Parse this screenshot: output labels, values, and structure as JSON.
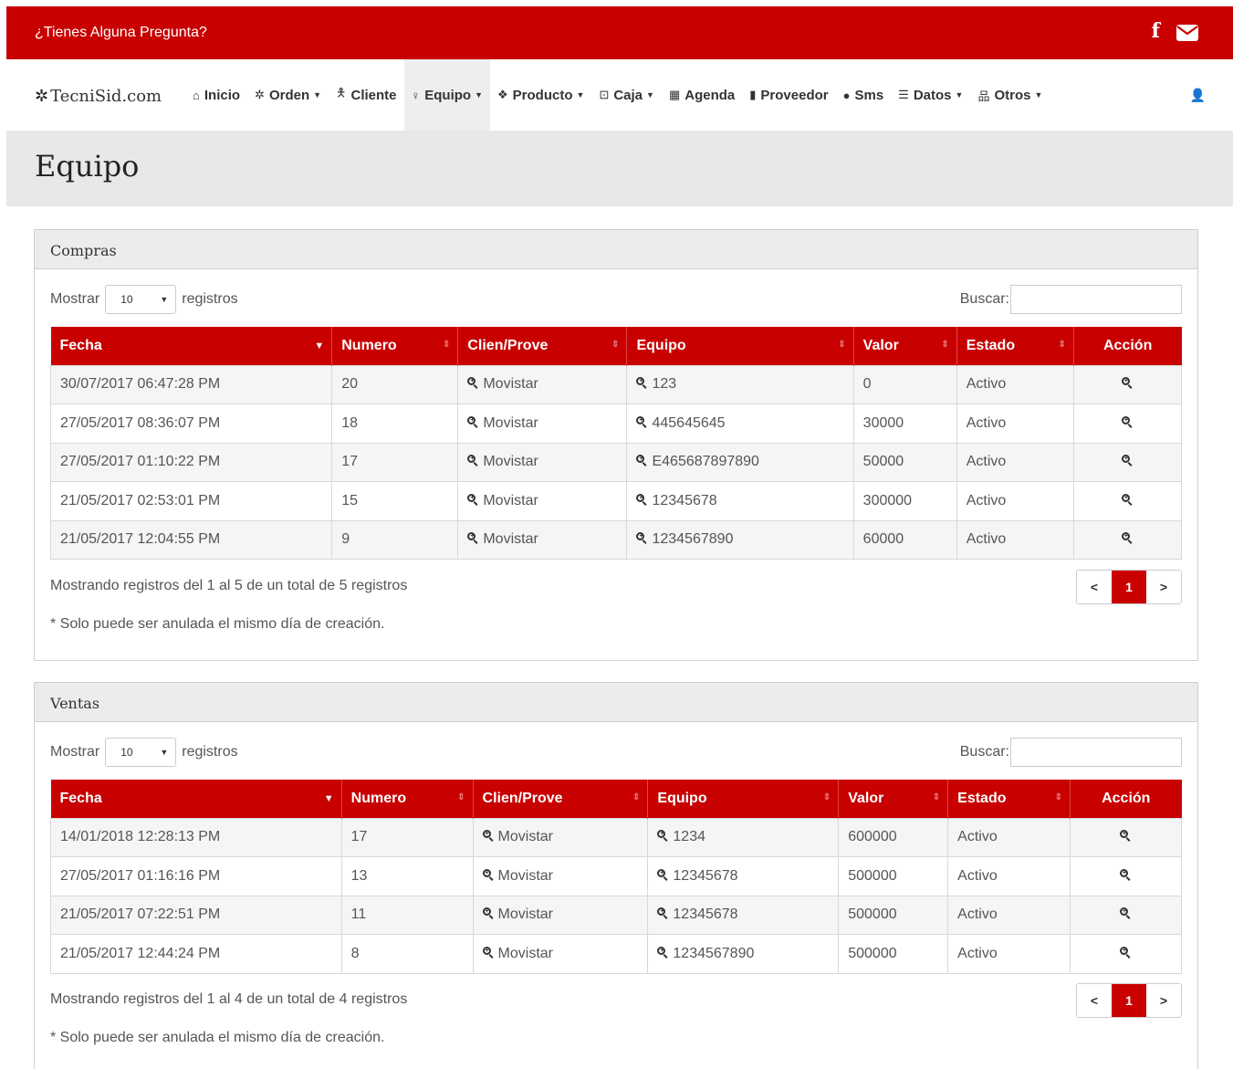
{
  "topbar": {
    "question": "¿Tienes Alguna Pregunta?",
    "icons": [
      "facebook-icon",
      "envelope-icon"
    ]
  },
  "brand": {
    "name": "TecniSid.com",
    "icon": "cog-icon"
  },
  "nav": {
    "items": [
      {
        "label": "Inicio",
        "icon": "home-icon",
        "dropdown": false
      },
      {
        "label": "Orden",
        "icon": "cog-icon",
        "dropdown": true
      },
      {
        "label": "Cliente",
        "icon": "male-icon",
        "dropdown": false
      },
      {
        "label": "Equipo",
        "icon": "lightbulb-icon",
        "dropdown": true,
        "active": true
      },
      {
        "label": "Producto",
        "icon": "cubes-icon",
        "dropdown": true
      },
      {
        "label": "Caja",
        "icon": "money-icon",
        "dropdown": true
      },
      {
        "label": "Agenda",
        "icon": "calendar-icon",
        "dropdown": false
      },
      {
        "label": "Proveedor",
        "icon": "building-icon",
        "dropdown": false
      },
      {
        "label": "Sms",
        "icon": "comment-icon",
        "dropdown": false
      },
      {
        "label": "Datos",
        "icon": "list-icon",
        "dropdown": true
      },
      {
        "label": "Otros",
        "icon": "sitemap-icon",
        "dropdown": true
      }
    ],
    "user_icon": "user-icon"
  },
  "page": {
    "title": "Equipo"
  },
  "compras": {
    "title": "Compras",
    "show_label": "Mostrar",
    "length_value": "10",
    "records_label": "registros",
    "search_label": "Buscar:",
    "columns": [
      "Fecha",
      "Numero",
      "Clien/Prove",
      "Equipo",
      "Valor",
      "Estado",
      "Acción"
    ],
    "rows": [
      {
        "fecha": "30/07/2017 06:47:28 PM",
        "numero": "20",
        "cliente": "Movistar",
        "equipo": "123",
        "valor": "0",
        "estado": "Activo"
      },
      {
        "fecha": "27/05/2017 08:36:07 PM",
        "numero": "18",
        "cliente": "Movistar",
        "equipo": "445645645",
        "valor": "30000",
        "estado": "Activo"
      },
      {
        "fecha": "27/05/2017 01:10:22 PM",
        "numero": "17",
        "cliente": "Movistar",
        "equipo": "E465687897890",
        "valor": "50000",
        "estado": "Activo"
      },
      {
        "fecha": "21/05/2017 02:53:01 PM",
        "numero": "15",
        "cliente": "Movistar",
        "equipo": "12345678",
        "valor": "300000",
        "estado": "Activo"
      },
      {
        "fecha": "21/05/2017 12:04:55 PM",
        "numero": "9",
        "cliente": "Movistar",
        "equipo": "1234567890",
        "valor": "60000",
        "estado": "Activo"
      }
    ],
    "info": "Mostrando registros del 1 al 5 de un total de 5 registros",
    "pager": {
      "prev": "<",
      "current": "1",
      "next": ">"
    },
    "note": "* Solo puede ser anulada el mismo día de creación."
  },
  "ventas": {
    "title": "Ventas",
    "show_label": "Mostrar",
    "length_value": "10",
    "records_label": "registros",
    "search_label": "Buscar:",
    "columns": [
      "Fecha",
      "Numero",
      "Clien/Prove",
      "Equipo",
      "Valor",
      "Estado",
      "Acción"
    ],
    "rows": [
      {
        "fecha": "14/01/2018 12:28:13 PM",
        "numero": "17",
        "cliente": "Movistar",
        "equipo": "1234",
        "valor": "600000",
        "estado": "Activo"
      },
      {
        "fecha": "27/05/2017 01:16:16 PM",
        "numero": "13",
        "cliente": "Movistar",
        "equipo": "12345678",
        "valor": "500000",
        "estado": "Activo"
      },
      {
        "fecha": "21/05/2017 07:22:51 PM",
        "numero": "11",
        "cliente": "Movistar",
        "equipo": "12345678",
        "valor": "500000",
        "estado": "Activo"
      },
      {
        "fecha": "21/05/2017 12:44:24 PM",
        "numero": "8",
        "cliente": "Movistar",
        "equipo": "1234567890",
        "valor": "500000",
        "estado": "Activo"
      }
    ],
    "info": "Mostrando registros del 1 al 4 de un total de 4 registros",
    "pager": {
      "prev": "<",
      "current": "1",
      "next": ">"
    },
    "note": "* Solo puede ser anulada el mismo día de creación."
  }
}
